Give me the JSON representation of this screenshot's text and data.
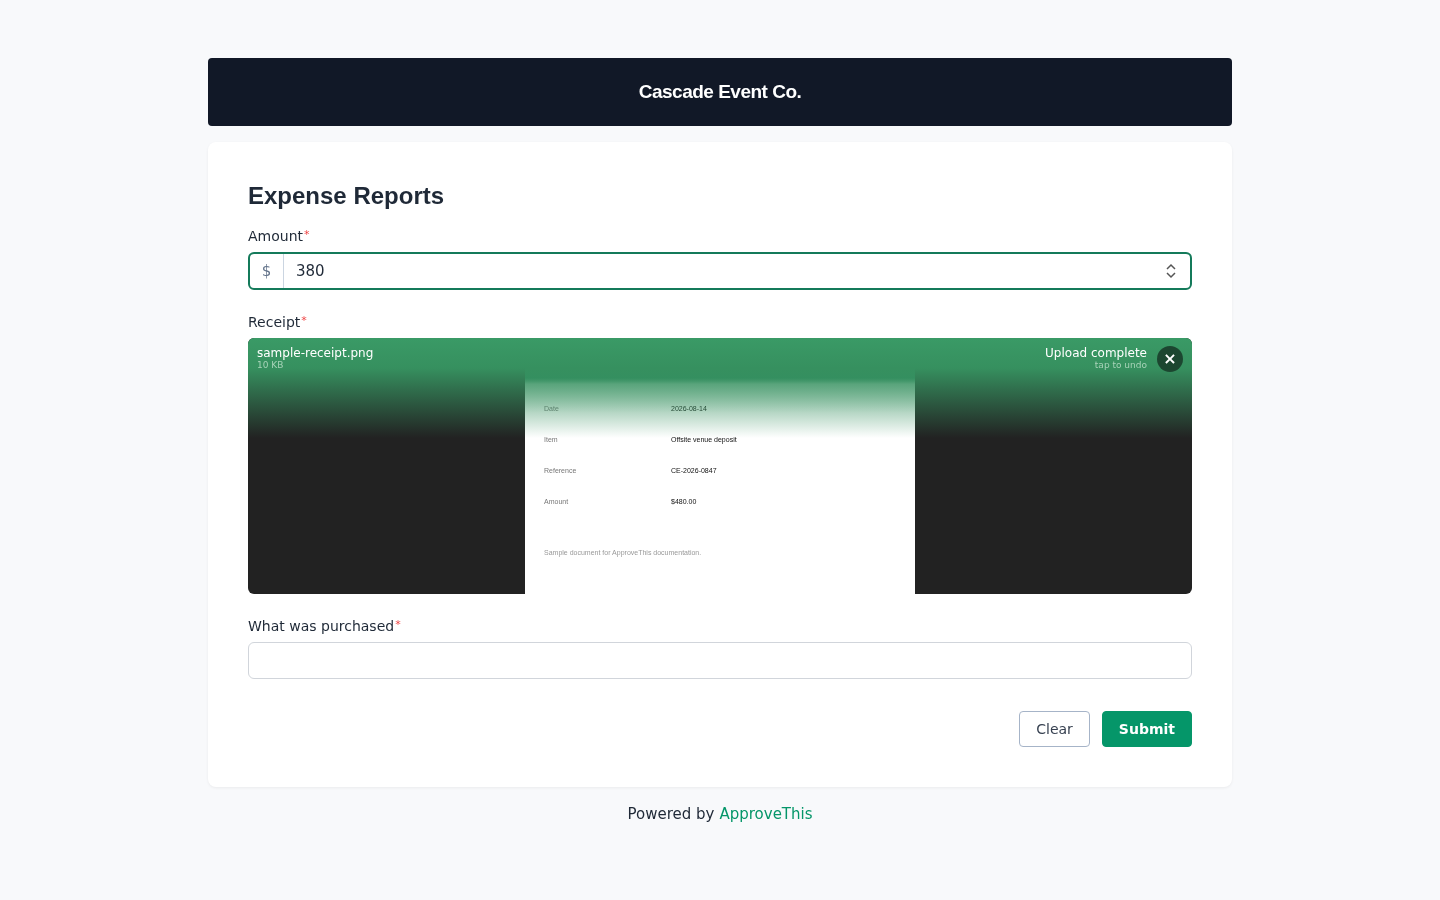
{
  "header": {
    "title": "Cascade Event Co."
  },
  "form": {
    "title": "Expense Reports",
    "amount": {
      "label": "Amount",
      "required_mark": "*",
      "prefix": "$",
      "value": "380",
      "focused": true
    },
    "receipt": {
      "label": "Receipt",
      "required_mark": "*",
      "file_name": "sample-receipt.png",
      "file_size": "10 KB",
      "status": "Upload complete",
      "status_hint": "tap to undo",
      "close": "×",
      "document": {
        "rows": [
          {
            "label": "Date",
            "value": "2026-08-14"
          },
          {
            "label": "Item",
            "value": "Offsite venue deposit"
          },
          {
            "label": "Reference",
            "value": "CE-2026-0847"
          },
          {
            "label": "Amount",
            "value": "$480.00"
          }
        ],
        "footer": "Sample document for ApproveThis documentation."
      }
    },
    "purchased": {
      "label": "What was purchased",
      "required_mark": "*",
      "focused": false
    },
    "buttons": [
      {
        "label": "Clear",
        "kind": "secondary"
      },
      {
        "label": "Submit",
        "kind": "primary"
      }
    ]
  },
  "footer": {
    "text": "Powered by",
    "link": "ApproveThis"
  }
}
